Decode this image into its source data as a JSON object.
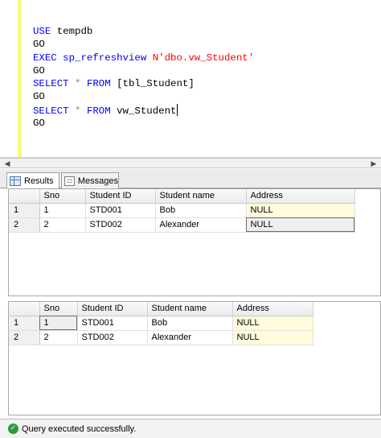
{
  "editor": {
    "lines": [
      [
        {
          "t": "USE",
          "c": "kw"
        },
        {
          "t": " tempdb",
          "c": "plain"
        }
      ],
      [
        {
          "t": "GO",
          "c": "plain"
        }
      ],
      [
        {
          "t": "EXEC",
          "c": "kw"
        },
        {
          "t": " sp_refreshview ",
          "c": "kw"
        },
        {
          "t": "N'dbo.vw_Student'",
          "c": "str"
        }
      ],
      [
        {
          "t": "GO",
          "c": "plain"
        }
      ],
      [
        {
          "t": "SELECT",
          "c": "kw"
        },
        {
          "t": " * ",
          "c": "op"
        },
        {
          "t": "FROM",
          "c": "kw"
        },
        {
          "t": " [tbl_Student]",
          "c": "plain"
        }
      ],
      [
        {
          "t": "GO",
          "c": "plain"
        }
      ],
      [
        {
          "t": "SELECT",
          "c": "kw"
        },
        {
          "t": " * ",
          "c": "op"
        },
        {
          "t": "FROM",
          "c": "kw"
        },
        {
          "t": " vw_Student",
          "c": "plain"
        }
      ],
      [
        {
          "t": "GO",
          "c": "plain"
        }
      ]
    ]
  },
  "tabs": {
    "results": "Results",
    "messages": "Messages"
  },
  "grid1": {
    "headers": [
      "Sno",
      "Student ID",
      "Student name",
      "Address"
    ],
    "rows": [
      {
        "num": "1",
        "cells": [
          "1",
          "STD001",
          "Bob",
          "NULL"
        ]
      },
      {
        "num": "2",
        "cells": [
          "2",
          "STD002",
          "Alexander",
          "NULL"
        ]
      }
    ]
  },
  "grid2": {
    "headers": [
      "Sno",
      "Student ID",
      "Student name",
      "Address"
    ],
    "rows": [
      {
        "num": "1",
        "cells": [
          "1",
          "STD001",
          "Bob",
          "NULL"
        ]
      },
      {
        "num": "2",
        "cells": [
          "2",
          "STD002",
          "Alexander",
          "NULL"
        ]
      }
    ]
  },
  "status": {
    "text": "Query executed successfully.",
    "icon": "check-circle-icon",
    "color": "#2e9b3a"
  }
}
